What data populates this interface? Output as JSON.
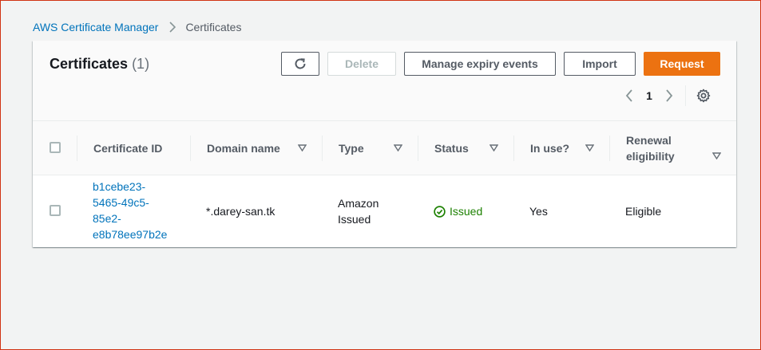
{
  "breadcrumb": {
    "root": "AWS Certificate Manager",
    "current": "Certificates"
  },
  "panel": {
    "title": "Certificates",
    "count": "(1)"
  },
  "toolbar": {
    "refresh_icon": "refresh-icon",
    "delete_label": "Delete",
    "manage_label": "Manage expiry events",
    "import_label": "Import",
    "request_label": "Request",
    "accent_color": "#ec7211"
  },
  "pagination": {
    "current_page": "1",
    "settings_icon": "gear-icon"
  },
  "table": {
    "columns": {
      "certificate_id": "Certificate ID",
      "domain_name": "Domain name",
      "type": "Type",
      "status": "Status",
      "in_use": "In use?",
      "renewal_line1": "Renewal",
      "renewal_line2": "eligibility"
    },
    "rows": [
      {
        "certificate_id_lines": [
          "b1cebe23-",
          "5465-49c5-",
          "85e2-",
          "e8b78ee97b2e"
        ],
        "domain_name": "*.darey-san.tk",
        "type_lines": [
          "Amazon",
          "Issued"
        ],
        "status": "Issued",
        "status_color": "#1d8102",
        "in_use": "Yes",
        "renewal_eligibility": "Eligible"
      }
    ]
  }
}
